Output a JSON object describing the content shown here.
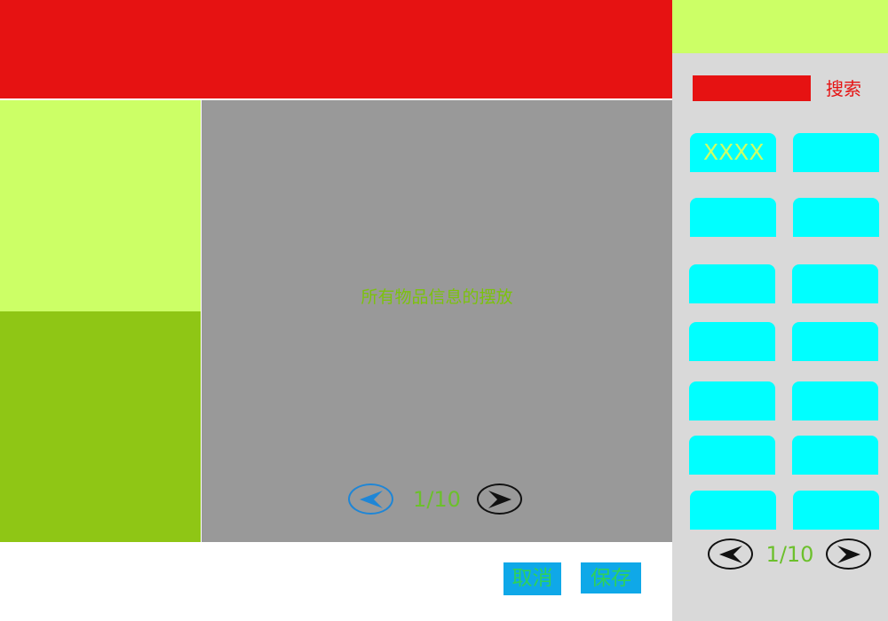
{
  "center": {
    "label": "所有物品信息的摆放",
    "pager": {
      "text": "1/10"
    }
  },
  "actions": {
    "cancel_label": "取消",
    "save_label": "保存"
  },
  "sidebar": {
    "search": {
      "value": "",
      "label": "搜索"
    },
    "tiles": [
      {
        "label": "XXXX"
      },
      {
        "label": ""
      },
      {
        "label": ""
      },
      {
        "label": ""
      },
      {
        "label": ""
      },
      {
        "label": ""
      },
      {
        "label": ""
      },
      {
        "label": ""
      },
      {
        "label": ""
      },
      {
        "label": ""
      },
      {
        "label": ""
      },
      {
        "label": ""
      },
      {
        "label": ""
      },
      {
        "label": ""
      }
    ],
    "pager": {
      "text": "1/10"
    }
  },
  "colors": {
    "header_red": "#e61212",
    "lime": "#ccff66",
    "green": "#8fc615",
    "gray": "#999999",
    "cyan": "#00ffff",
    "button_blue": "#0fa8e8",
    "sidebar_gray": "#d9d9d9"
  },
  "icons": {
    "prev": "arrow-left-icon",
    "next": "arrow-right-icon"
  }
}
